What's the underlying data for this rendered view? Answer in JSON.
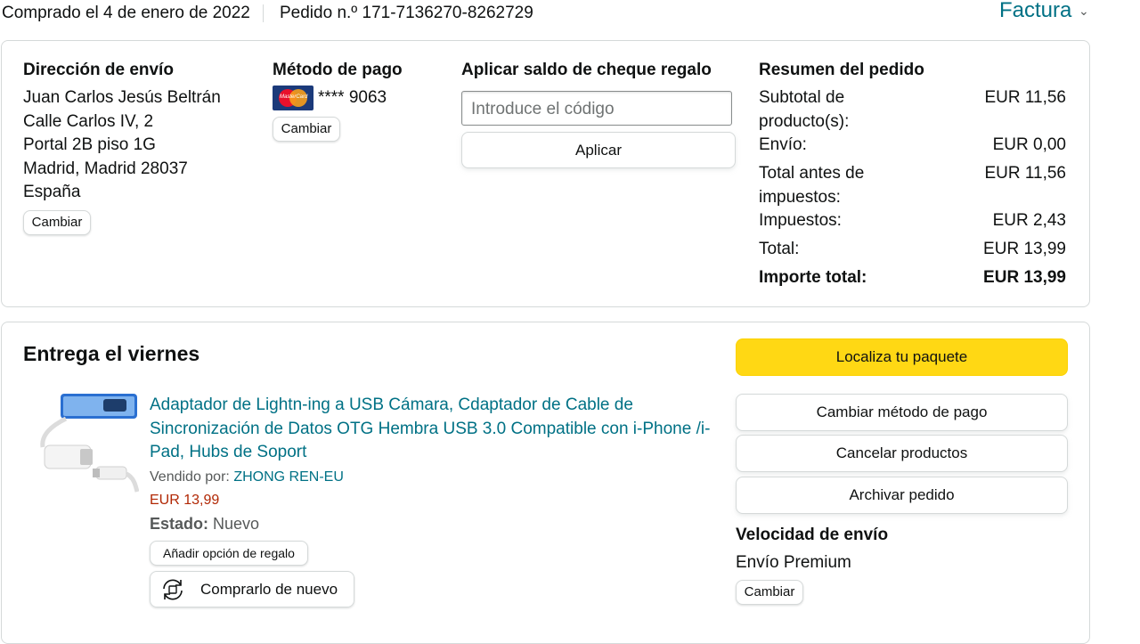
{
  "header": {
    "purchase_date": "Comprado el 4 de enero de 2022",
    "order_number": "Pedido n.º 171-7136270-8262729",
    "invoice_label": "Factura",
    "invoice_chevron": "⌄"
  },
  "shipping": {
    "title": "Dirección de envío",
    "lines": [
      "Juan Carlos Jesús Beltrán",
      "Calle Carlos IV, 2",
      "Portal 2B piso 1G",
      "Madrid, Madrid 28037",
      "España"
    ],
    "change_label": "Cambiar"
  },
  "payment": {
    "title": "Método de pago",
    "card_brand_text": "MasterCard",
    "card_number": "**** 9063",
    "change_label": "Cambiar"
  },
  "gift": {
    "title": "Aplicar saldo de cheque regalo",
    "placeholder": "Introduce el código",
    "apply_label": "Aplicar"
  },
  "summary": {
    "title": "Resumen del pedido",
    "rows": [
      {
        "label": "Subtotal de producto(s):",
        "value": "EUR 11,56"
      },
      {
        "label": "Envío:",
        "value": "EUR 0,00"
      },
      {
        "label": "Total antes de impuestos:",
        "value": "EUR 11,56"
      },
      {
        "label": "Impuestos:",
        "value": "EUR 2,43"
      },
      {
        "label": "Total:",
        "value": "EUR 13,99"
      },
      {
        "label": "Importe total:",
        "value": "EUR 13,99"
      }
    ]
  },
  "delivery": {
    "title": "Entrega el viernes",
    "product": {
      "title": "Adaptador de Lightn-ing a USB Cámara, Cdaptador de Cable de Sincronización de Datos OTG Hembra USB 3.0 Compatible con i-Phone /i-Pad, Hubs de Soport",
      "sold_by_label": "Vendido por:",
      "seller": "ZHONG REN-EU",
      "price": "EUR 13,99",
      "state_label": "Estado:",
      "state_value": "Nuevo",
      "gift_option_label": "Añadir opción de regalo",
      "buy_again_label": "Comprarlo de nuevo"
    },
    "actions": {
      "track": "Localiza tu paquete",
      "change_payment": "Cambiar método de pago",
      "cancel": "Cancelar productos",
      "archive": "Archivar pedido"
    },
    "speed": {
      "title": "Velocidad de envío",
      "value": "Envío Premium",
      "change_label": "Cambiar"
    }
  },
  "colors": {
    "link": "#007185",
    "price": "#B12704",
    "primary_button": "#FFD814"
  }
}
